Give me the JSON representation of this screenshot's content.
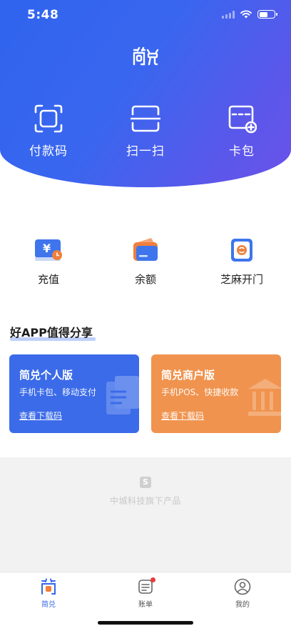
{
  "status_bar": {
    "time": "5:48"
  },
  "hero": {
    "actions": [
      {
        "label": "付款码",
        "icon": "scan-frame-icon"
      },
      {
        "label": "扫一扫",
        "icon": "scan-line-icon"
      },
      {
        "label": "卡包",
        "icon": "card-add-icon"
      }
    ]
  },
  "services": [
    {
      "label": "充值",
      "icon": "recharge-icon"
    },
    {
      "label": "余额",
      "icon": "wallet-icon"
    },
    {
      "label": "芝麻开门",
      "icon": "open-door-icon"
    }
  ],
  "share": {
    "title": "好APP值得分享",
    "cards": [
      {
        "title": "简兑个人版",
        "subtitle": "手机卡包、移动支付",
        "link": "查看下载码",
        "color": "#3b6be9"
      },
      {
        "title": "简兑商户版",
        "subtitle": "手机POS、快捷收款",
        "link": "查看下载码",
        "color": "#f0934e"
      }
    ]
  },
  "footer": {
    "brand_text": "中城科技旗下产品",
    "brand_icon_letter": "S"
  },
  "tabbar": {
    "tabs": [
      {
        "label": "简兑",
        "active": true,
        "icon": "home-logo-icon"
      },
      {
        "label": "账单",
        "active": false,
        "icon": "bill-icon",
        "badge": true
      },
      {
        "label": "我的",
        "active": false,
        "icon": "user-icon"
      }
    ]
  },
  "colors": {
    "primary": "#3467e8",
    "accent_orange": "#f0934e",
    "badge_red": "#e93b3b"
  }
}
